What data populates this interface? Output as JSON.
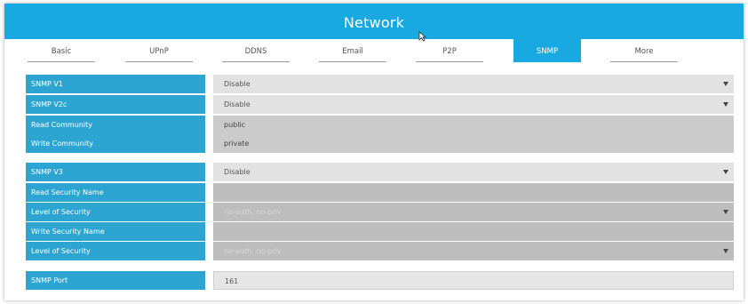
{
  "window": {
    "title": "Network"
  },
  "tabs": [
    {
      "label": "Basic"
    },
    {
      "label": "UPnP"
    },
    {
      "label": "DDNS"
    },
    {
      "label": "Email"
    },
    {
      "label": "P2P"
    },
    {
      "label": "SNMP",
      "active": true
    },
    {
      "label": "More"
    }
  ],
  "form": {
    "snmp_v1": {
      "label": "SNMP V1",
      "value": "Disable"
    },
    "snmp_v2c": {
      "label": "SNMP V2c",
      "value": "Disable"
    },
    "read_community": {
      "label": "Read Community",
      "value": "public"
    },
    "write_community": {
      "label": "Write Community",
      "value": "private"
    },
    "snmp_v3": {
      "label": "SNMP V3",
      "value": "Disable"
    },
    "read_security_name": {
      "label": "Read Security Name",
      "value": ""
    },
    "read_level_of_security": {
      "label": "Level of Security",
      "value": "no-auth, no-priv"
    },
    "write_security_name": {
      "label": "Write Security Name",
      "value": ""
    },
    "write_level_of_security": {
      "label": "Level of Security",
      "value": "no-auth, no-priv"
    },
    "snmp_port": {
      "label": "SNMP Port",
      "value": "161"
    }
  },
  "colors": {
    "accent": "#17a9e0",
    "label_bg": "#2da5d2",
    "field_bg": "#e2e2e2",
    "text_field_bg": "#cbcbcb",
    "disabled_bg": "#bdbdbd"
  }
}
